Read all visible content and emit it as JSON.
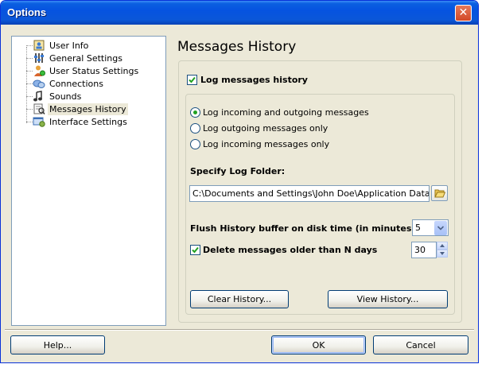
{
  "window": {
    "title": "Options"
  },
  "tree": {
    "items": [
      {
        "label": "User Info",
        "icon": "user-info-icon"
      },
      {
        "label": "General Settings",
        "icon": "general-settings-icon"
      },
      {
        "label": "User Status Settings",
        "icon": "user-status-icon"
      },
      {
        "label": "Connections",
        "icon": "connections-icon"
      },
      {
        "label": "Sounds",
        "icon": "sounds-icon"
      },
      {
        "label": "Messages History",
        "icon": "messages-history-icon",
        "selected": true
      },
      {
        "label": "Interface Settings",
        "icon": "interface-settings-icon"
      }
    ]
  },
  "panel": {
    "title": "Messages History",
    "log_history": {
      "label": "Log messages history",
      "checked": true
    },
    "radios": [
      {
        "label": "Log incoming and outgoing messages",
        "checked": true
      },
      {
        "label": "Log outgoing messages only",
        "checked": false
      },
      {
        "label": "Log incoming messages only",
        "checked": false
      }
    ],
    "folder": {
      "label": "Specify Log Folder:",
      "value": "C:\\Documents and Settings\\John Doe\\Application Data\\LeadM"
    },
    "flush": {
      "label": "Flush History buffer on disk time (in minutes):",
      "value": "5"
    },
    "delete_old": {
      "label": "Delete messages older than N days",
      "checked": true,
      "value": "30"
    },
    "clear_button": "Clear History...",
    "view_button": "View History..."
  },
  "footer": {
    "help_button": "Help...",
    "ok_button": "OK",
    "cancel_button": "Cancel"
  },
  "colors": {
    "titlebar": "#0653e0",
    "dialog_bg": "#ece9d8",
    "check_green": "#21a121"
  }
}
